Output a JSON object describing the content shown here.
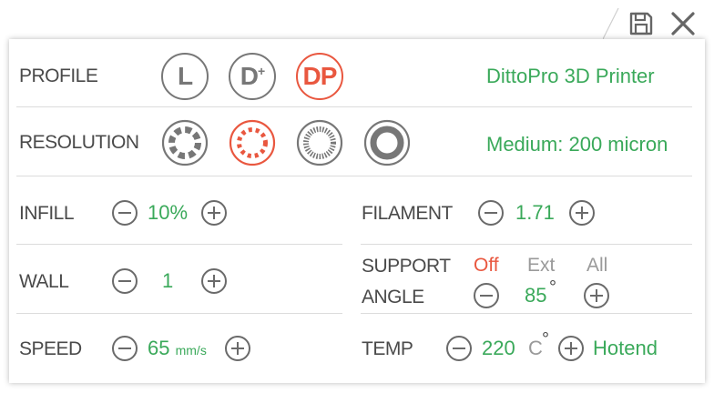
{
  "colors": {
    "accent": "#e9573f",
    "value": "#3aa95a",
    "icon": "#6a6a6a"
  },
  "toolbar": {
    "save_icon": "floppy-disk-icon",
    "close_icon": "close-x-icon"
  },
  "profile": {
    "label": "PROFILE",
    "options": [
      "L",
      "D",
      "DP"
    ],
    "d_superscript": "+",
    "selected": "DP",
    "value": "DittoPro 3D Printer"
  },
  "resolution": {
    "label": "RESOLUTION",
    "selected_index": 1,
    "value": "Medium: 200 micron"
  },
  "infill": {
    "label": "INFILL",
    "value": "10%"
  },
  "filament": {
    "label": "FILAMENT",
    "value": "1.71"
  },
  "wall": {
    "label": "WALL",
    "value": "1"
  },
  "support": {
    "label": "SUPPORT",
    "options": [
      "Off",
      "Ext",
      "All"
    ],
    "selected": "Off"
  },
  "angle": {
    "label": "ANGLE",
    "value": "85",
    "degree": "°"
  },
  "speed": {
    "label": "SPEED",
    "value": "65",
    "unit": "mm/s"
  },
  "temp": {
    "label": "TEMP",
    "value": "220",
    "unit": "C",
    "degree": "°",
    "target": "Hotend"
  }
}
